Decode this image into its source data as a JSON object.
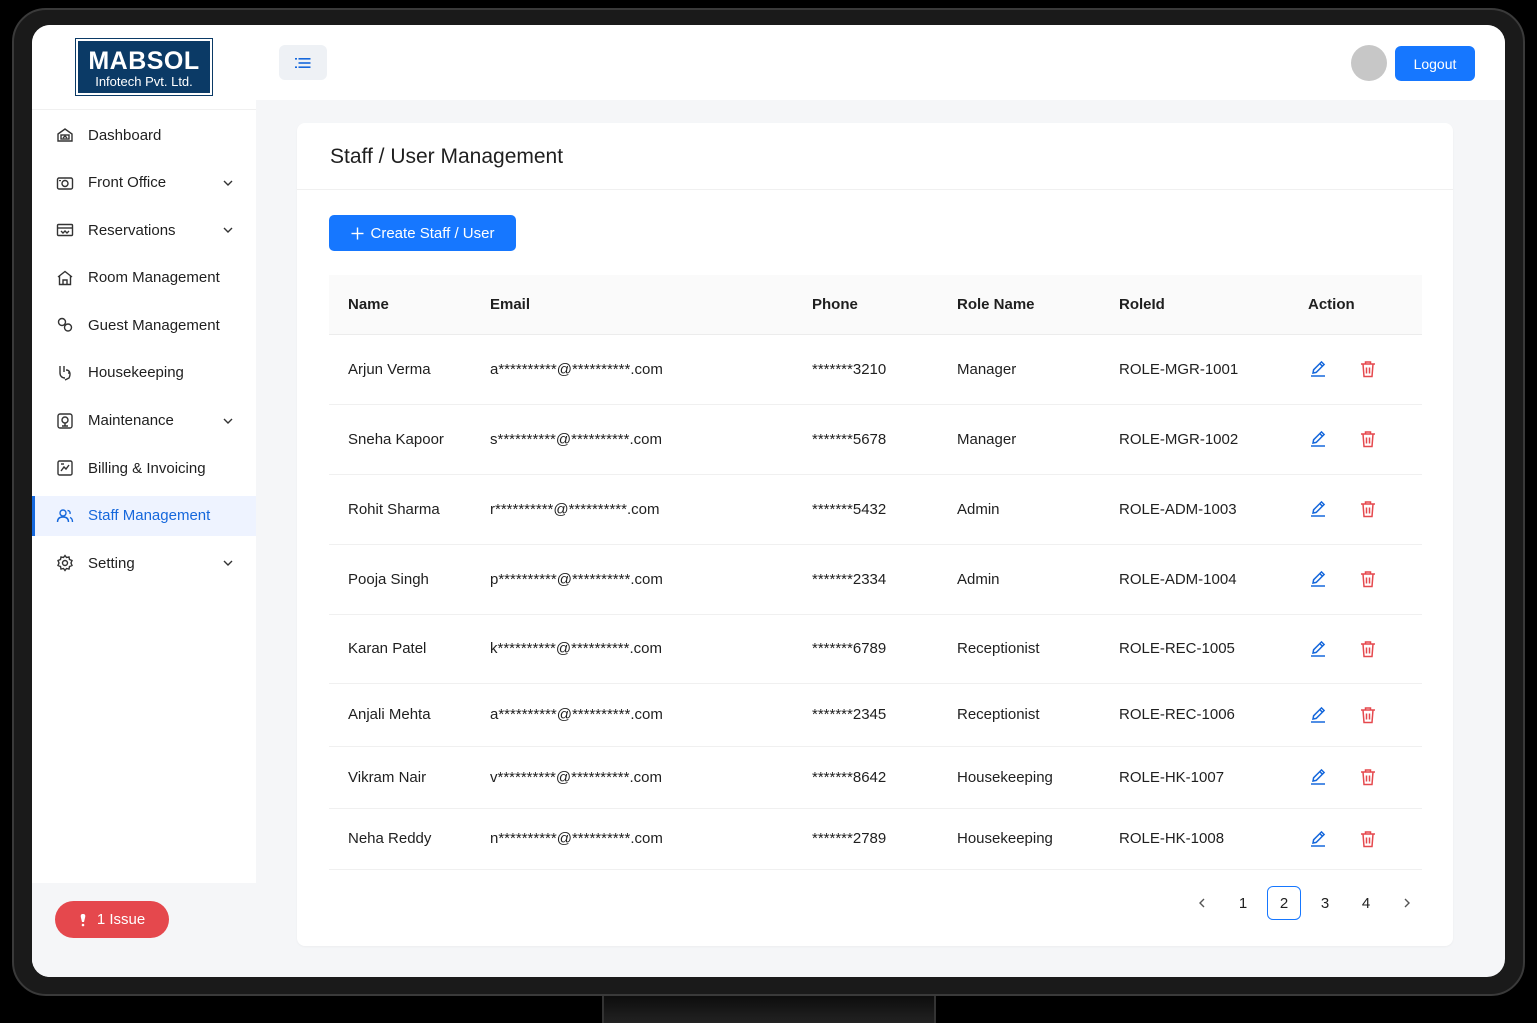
{
  "brand": {
    "line1": "MABSOL",
    "line2": "Infotech Pvt. Ltd."
  },
  "sidebar": {
    "items": [
      {
        "label": "Dashboard",
        "icon": "dashboard-icon",
        "has_submenu": false,
        "active": false
      },
      {
        "label": "Front Office",
        "icon": "camera-icon",
        "has_submenu": true,
        "active": false
      },
      {
        "label": "Reservations",
        "icon": "ticket-icon",
        "has_submenu": true,
        "active": false
      },
      {
        "label": "Room Management",
        "icon": "home-icon",
        "has_submenu": false,
        "active": false
      },
      {
        "label": "Guest Management",
        "icon": "guests-icon",
        "has_submenu": false,
        "active": false
      },
      {
        "label": "Housekeeping",
        "icon": "broom-icon",
        "has_submenu": false,
        "active": false
      },
      {
        "label": "Maintenance",
        "icon": "tools-icon",
        "has_submenu": true,
        "active": false
      },
      {
        "label": "Billing & Invoicing",
        "icon": "invoice-icon",
        "has_submenu": false,
        "active": false
      },
      {
        "label": "Staff Management",
        "icon": "users-icon",
        "has_submenu": false,
        "active": true
      },
      {
        "label": "Setting",
        "icon": "gear-icon",
        "has_submenu": true,
        "active": false
      }
    ],
    "issue_label": "1 Issue"
  },
  "header": {
    "logout_label": "Logout"
  },
  "page": {
    "title": "Staff / User Management",
    "create_label": "Create Staff / User"
  },
  "table": {
    "columns": [
      "Name",
      "Email",
      "Phone",
      "Role Name",
      "RoleId",
      "Action"
    ],
    "rows": [
      {
        "name": "Arjun Verma",
        "email": "a**********@**********.com",
        "phone": "*******3210",
        "role": "Manager",
        "role_id": "ROLE-MGR-1001"
      },
      {
        "name": "Sneha Kapoor",
        "email": "s**********@**********.com",
        "phone": "*******5678",
        "role": "Manager",
        "role_id": "ROLE-MGR-1002"
      },
      {
        "name": "Rohit Sharma",
        "email": "r**********@**********.com",
        "phone": "*******5432",
        "role": "Admin",
        "role_id": "ROLE-ADM-1003"
      },
      {
        "name": "Pooja Singh",
        "email": "p**********@**********.com",
        "phone": "*******2334",
        "role": "Admin",
        "role_id": "ROLE-ADM-1004"
      },
      {
        "name": "Karan Patel",
        "email": "k**********@**********.com",
        "phone": "*******6789",
        "role": "Receptionist",
        "role_id": "ROLE-REC-1005"
      },
      {
        "name": "Anjali Mehta",
        "email": "a**********@**********.com",
        "phone": "*******2345",
        "role": "Receptionist",
        "role_id": "ROLE-REC-1006"
      },
      {
        "name": "Vikram Nair",
        "email": "v**********@**********.com",
        "phone": "*******8642",
        "role": "Housekeeping",
        "role_id": "ROLE-HK-1007"
      },
      {
        "name": "Neha Reddy",
        "email": "n**********@**********.com",
        "phone": "*******2789",
        "role": "Housekeeping",
        "role_id": "ROLE-HK-1008"
      }
    ]
  },
  "pagination": {
    "pages": [
      "1",
      "2",
      "3",
      "4"
    ],
    "current": "2"
  },
  "colors": {
    "primary": "#1677ff",
    "danger": "#e5484d",
    "brand": "#0b3a66"
  }
}
